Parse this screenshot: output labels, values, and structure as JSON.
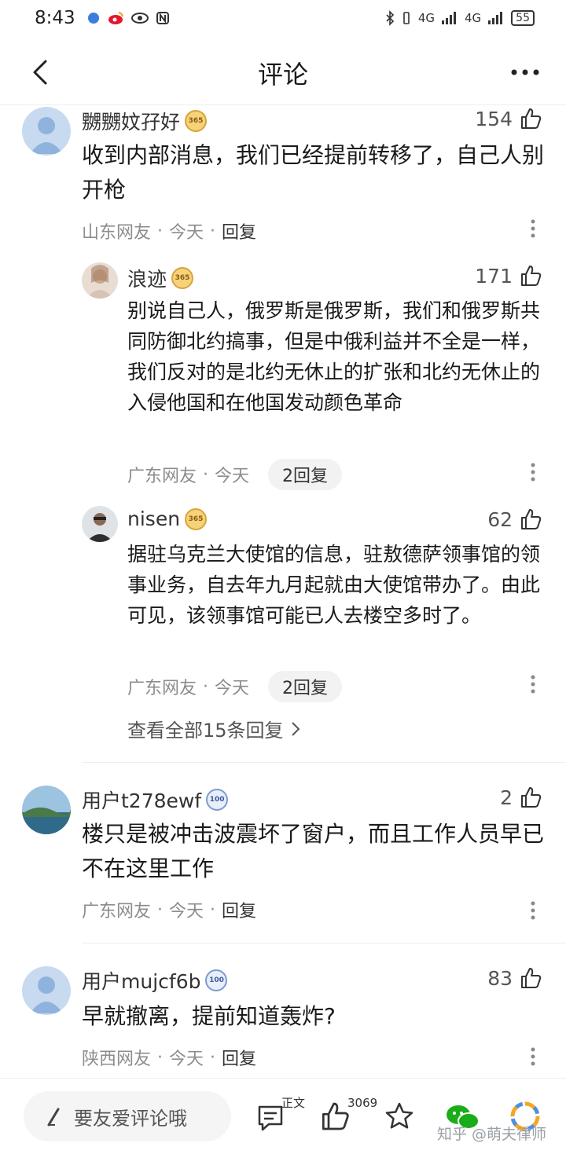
{
  "status_bar": {
    "time": "8:43",
    "signal1": "4G",
    "signal2": "4G",
    "battery": "55"
  },
  "header": {
    "title": "评论"
  },
  "comments": [
    {
      "author": "嬲嬲妏孖好",
      "badge": "365",
      "likes": "154",
      "text": "收到内部消息，我们已经提前转移了，自己人别开枪",
      "location": "山东网友",
      "time": "今天",
      "reply": "回复",
      "replies": [
        {
          "author": "浪迹",
          "badge": "365",
          "likes": "171",
          "text": "别说自己人，俄罗斯是俄罗斯，我们和俄罗斯共同防御北约搞事，但是中俄利益并不全是一样，我们反对的是北约无休止的扩张和北约无休止的入侵他国和在他国发动颜色革命",
          "location": "广东网友",
          "time": "今天",
          "reply_count": "2回复"
        },
        {
          "author": "nisen",
          "badge": "365",
          "likes": "62",
          "text": "据驻乌克兰大使馆的信息，驻敖德萨领事馆的领事业务，自去年九月起就由大使馆带办了。由此可见，该领事馆可能已人去楼空多时了。",
          "location": "广东网友",
          "time": "今天",
          "reply_count": "2回复"
        }
      ],
      "view_all": "查看全部15条回复"
    },
    {
      "author": "用户t278ewf",
      "badge": "100",
      "likes": "2",
      "text": "楼只是被冲击波震坏了窗户，而且工作人员早已不在这里工作",
      "location": "广东网友",
      "time": "今天",
      "reply": "回复"
    },
    {
      "author": "用户mujcf6b",
      "badge": "100",
      "likes": "83",
      "text": "早就撤离，提前知道轰炸?",
      "location": "陕西网友",
      "time": "今天",
      "reply": "回复"
    }
  ],
  "bottom_bar": {
    "input_placeholder": "要友爱评论哦",
    "comment_label": "正文",
    "like_count": "3069",
    "watermark": "知乎 @萌夫律师"
  },
  "colors": {
    "accent_gold": "#d8a53a",
    "badge_blue": "#7f9ad0",
    "wechat_green": "#1aad19"
  },
  "icons": [
    "back-arrow-icon",
    "more-icon",
    "thumb-up-icon",
    "more-vertical-icon",
    "pen-icon",
    "comment-icon",
    "star-icon",
    "wechat-icon",
    "moments-icon",
    "chevron-right-icon"
  ]
}
